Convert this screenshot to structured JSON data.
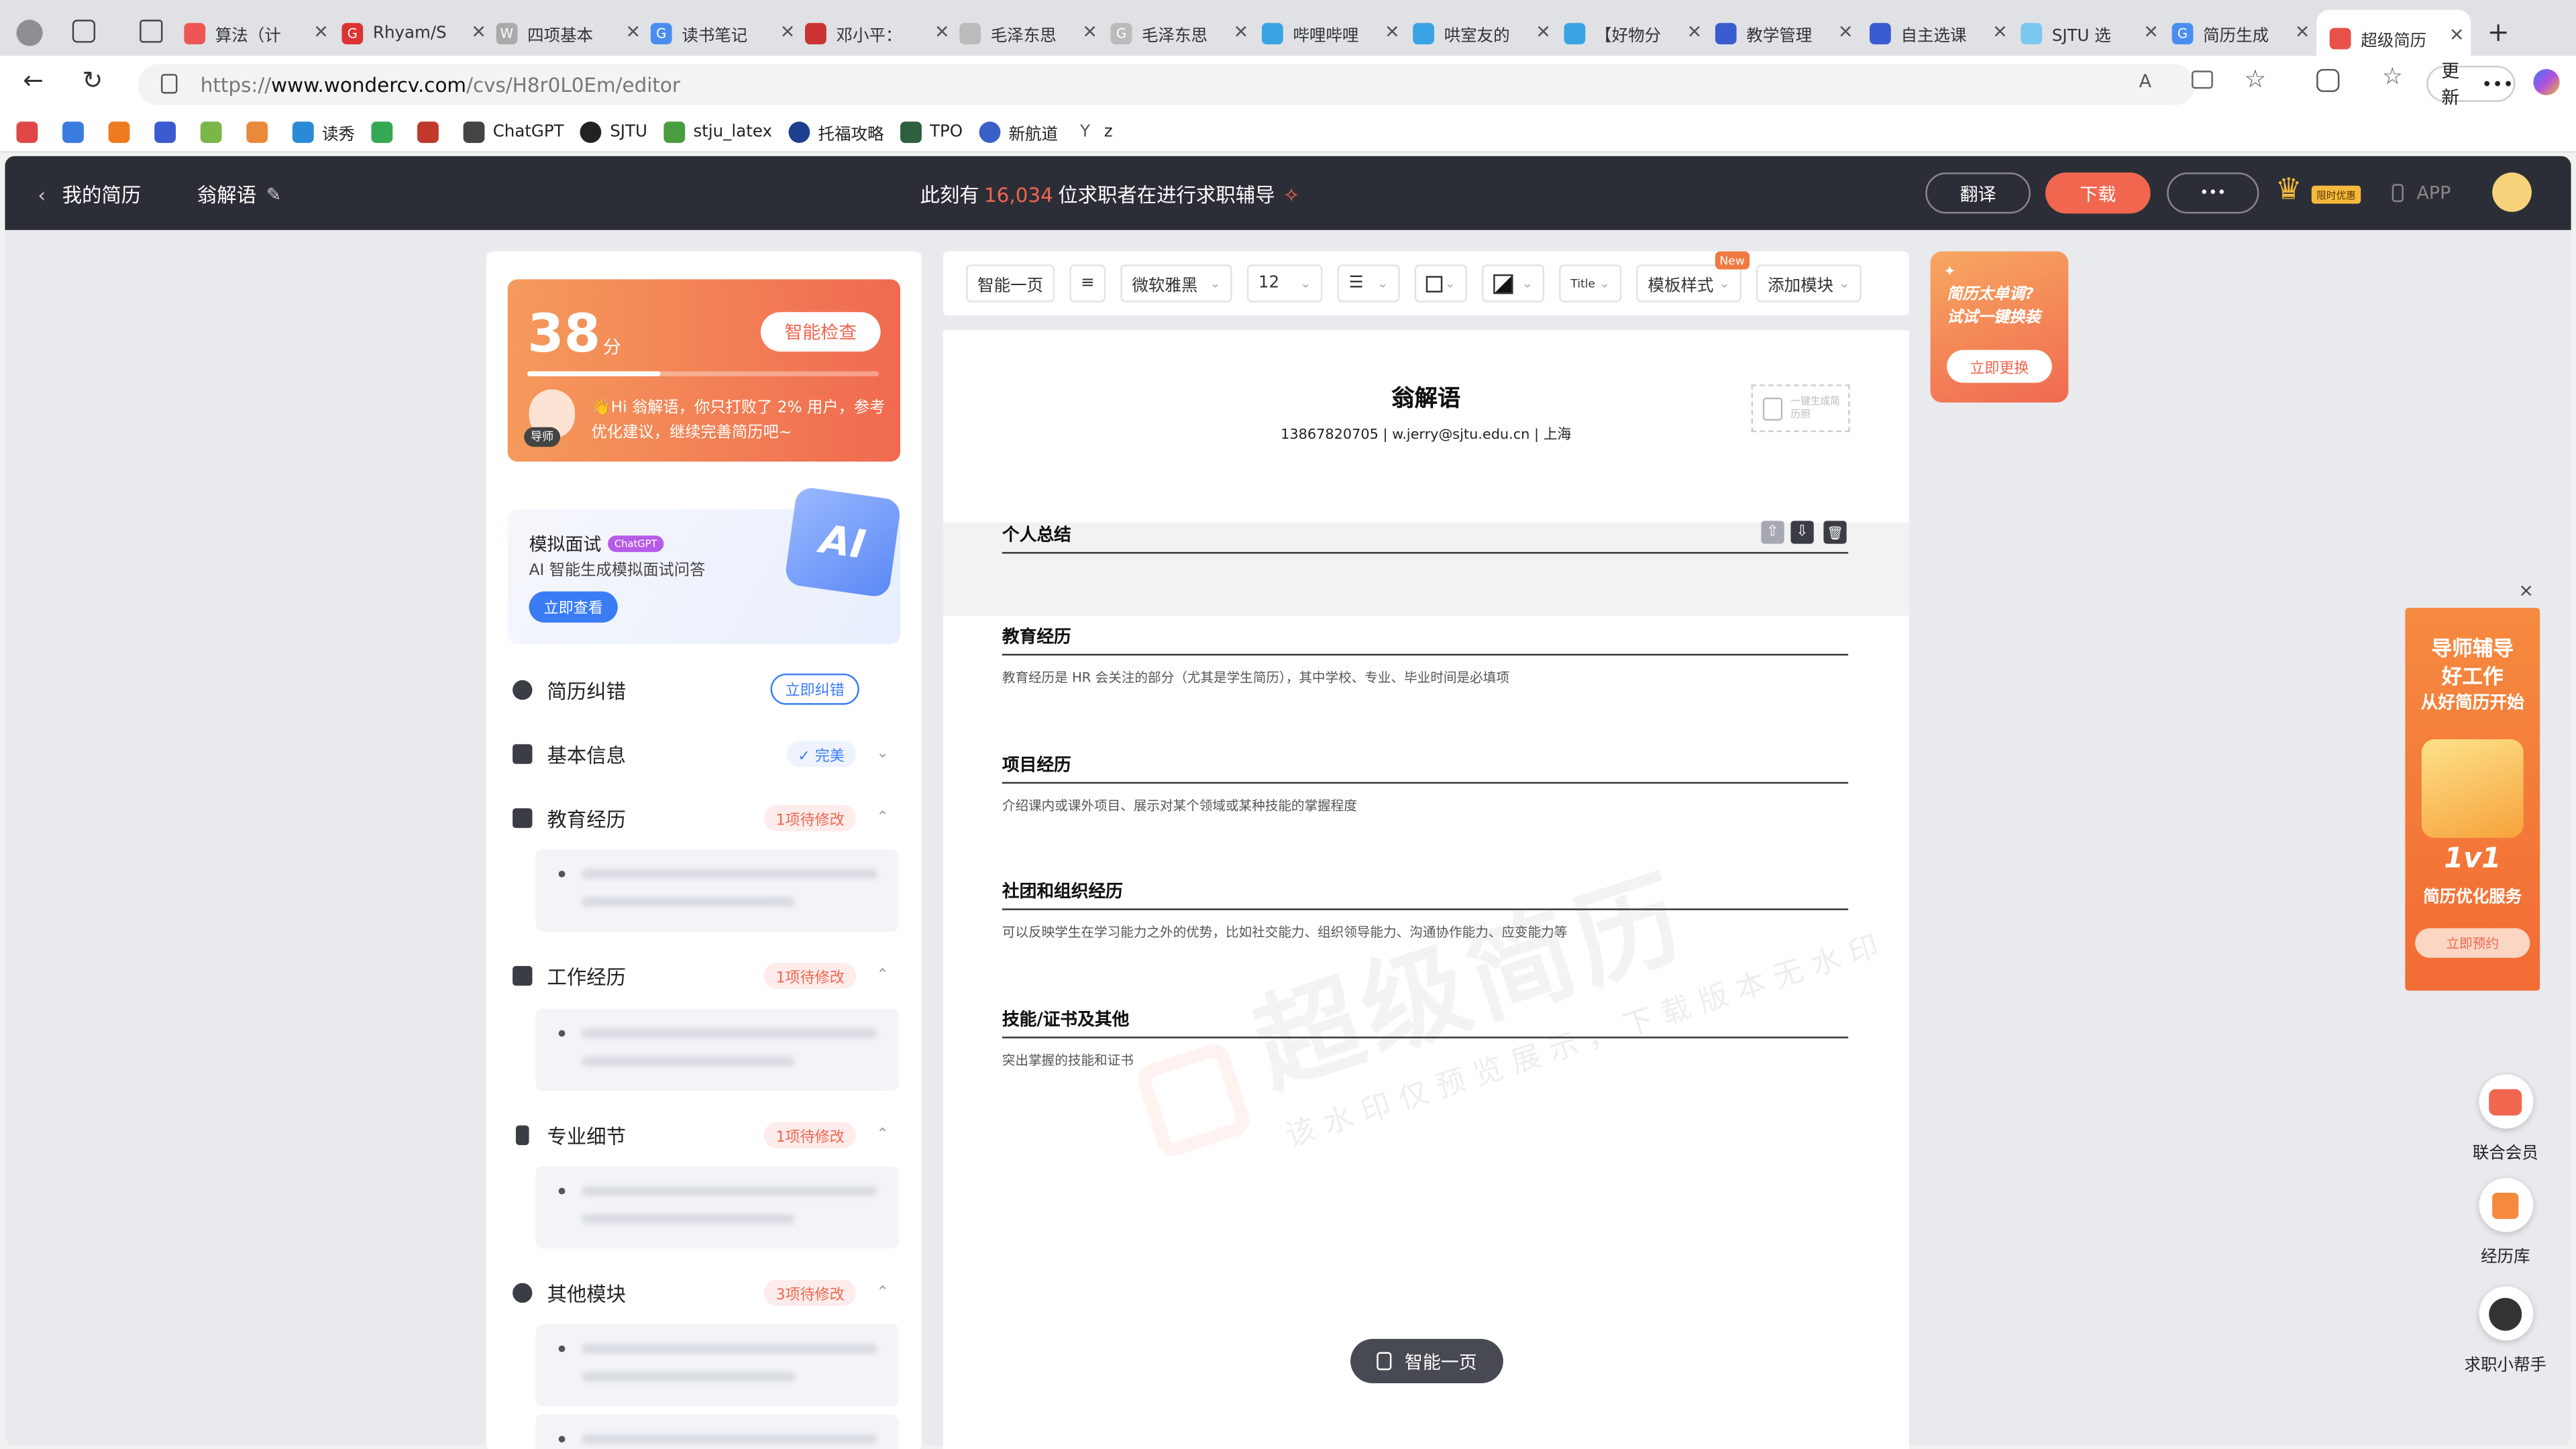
{
  "browser": {
    "tabs": [
      {
        "label": "算法（计"
      },
      {
        "label": "Rhyam/S"
      },
      {
        "label": "四项基本"
      },
      {
        "label": "读书笔记"
      },
      {
        "label": "邓小平："
      },
      {
        "label": "毛泽东思"
      },
      {
        "label": "毛泽东思"
      },
      {
        "label": "哔哩哔哩"
      },
      {
        "label": "哄室友的"
      },
      {
        "label": "【好物分"
      },
      {
        "label": "教学管理"
      },
      {
        "label": "自主选课"
      },
      {
        "label": "SJTU 选"
      },
      {
        "label": "简历生成"
      },
      {
        "label": "超级简历"
      }
    ],
    "url_prefix": "https://",
    "url_host": "www.wondercv.com",
    "url_path": "/cvs/H8r0L0Em/editor",
    "update_label": "更新",
    "bookmarks": [
      "读秀",
      "ChatGPT",
      "SJTU",
      "stju_latex",
      "托福攻略",
      "TPO",
      "新航道",
      "z"
    ]
  },
  "header": {
    "back_label": "我的简历",
    "resume_name": "翁解语",
    "center_prefix": "此刻有",
    "center_count": "16,034",
    "center_suffix": "位求职者在进行求职辅导",
    "translate_label": "翻译",
    "download_label": "下载",
    "more_label": "•••",
    "vip_badge": "限时优惠",
    "app_label": "APP"
  },
  "score_card": {
    "score": "38",
    "unit": "分",
    "check_label": "智能检查",
    "tip": "👋Hi 翁解语，你只打败了 2% 用户，参考优化建议，继续完善简历吧~",
    "mentor_label": "导师"
  },
  "ai_card": {
    "title": "模拟面试",
    "badge": "ChatGPT",
    "desc": "AI 智能生成模拟面试问答",
    "button": "立即查看",
    "art_text": "AI"
  },
  "modules": {
    "check": {
      "label": "简历纠错",
      "action": "立即纠错"
    },
    "basic": {
      "label": "基本信息",
      "status": "✓ 完美"
    },
    "education": {
      "label": "教育经历",
      "pending": "1项待修改"
    },
    "work": {
      "label": "工作经历",
      "pending": "1项待修改"
    },
    "details": {
      "label": "专业细节",
      "pending": "1项待修改"
    },
    "other": {
      "label": "其他模块",
      "pending": "3项待修改"
    }
  },
  "toolbar": {
    "one_page": "智能一页",
    "font": "微软雅黑",
    "size": "12",
    "template": "模板样式",
    "new_badge": "New",
    "add_module": "添加模块",
    "title_icon_text": "Title"
  },
  "resume": {
    "name": "翁解语",
    "contact": "13867820705 | w.jerry@sjtu.edu.cn | 上海",
    "photo_hint": "一键生成简历照",
    "sections": [
      {
        "title": "个人总结",
        "desc": ""
      },
      {
        "title": "教育经历",
        "desc": "教育经历是 HR 会关注的部分（尤其是学生简历），其中学校、专业、毕业时间是必填项"
      },
      {
        "title": "项目经历",
        "desc": "介绍课内或课外项目、展示对某个领域或某种技能的掌握程度"
      },
      {
        "title": "社团和组织经历",
        "desc": "可以反映学生在学习能力之外的优势，比如社交能力、组织领导能力、沟通协作能力、应变能力等"
      },
      {
        "title": "技能/证书及其他",
        "desc": "突出掌握的技能和证书"
      }
    ],
    "watermark_big": "超级简历",
    "watermark_small": "该水印仅预览展示，下载版本无水印",
    "floating_button": "智能一页"
  },
  "promo_small": {
    "line1": "简历太单调?",
    "line2": "试试一键换装",
    "button": "立即更换"
  },
  "promo_banner": {
    "line1": "导师辅导",
    "line2": "好工作",
    "line3": "从好简历开始",
    "big": "1v1",
    "line4": "简历优化服务",
    "button": "立即预约",
    "close": "×"
  },
  "right_actions": [
    {
      "label": "联合会员"
    },
    {
      "label": "经历库"
    },
    {
      "label": "求职小帮手"
    }
  ],
  "colors": {
    "accent": "#f0664f",
    "header_bg": "#2b2e36",
    "blue": "#3b7cf5"
  }
}
